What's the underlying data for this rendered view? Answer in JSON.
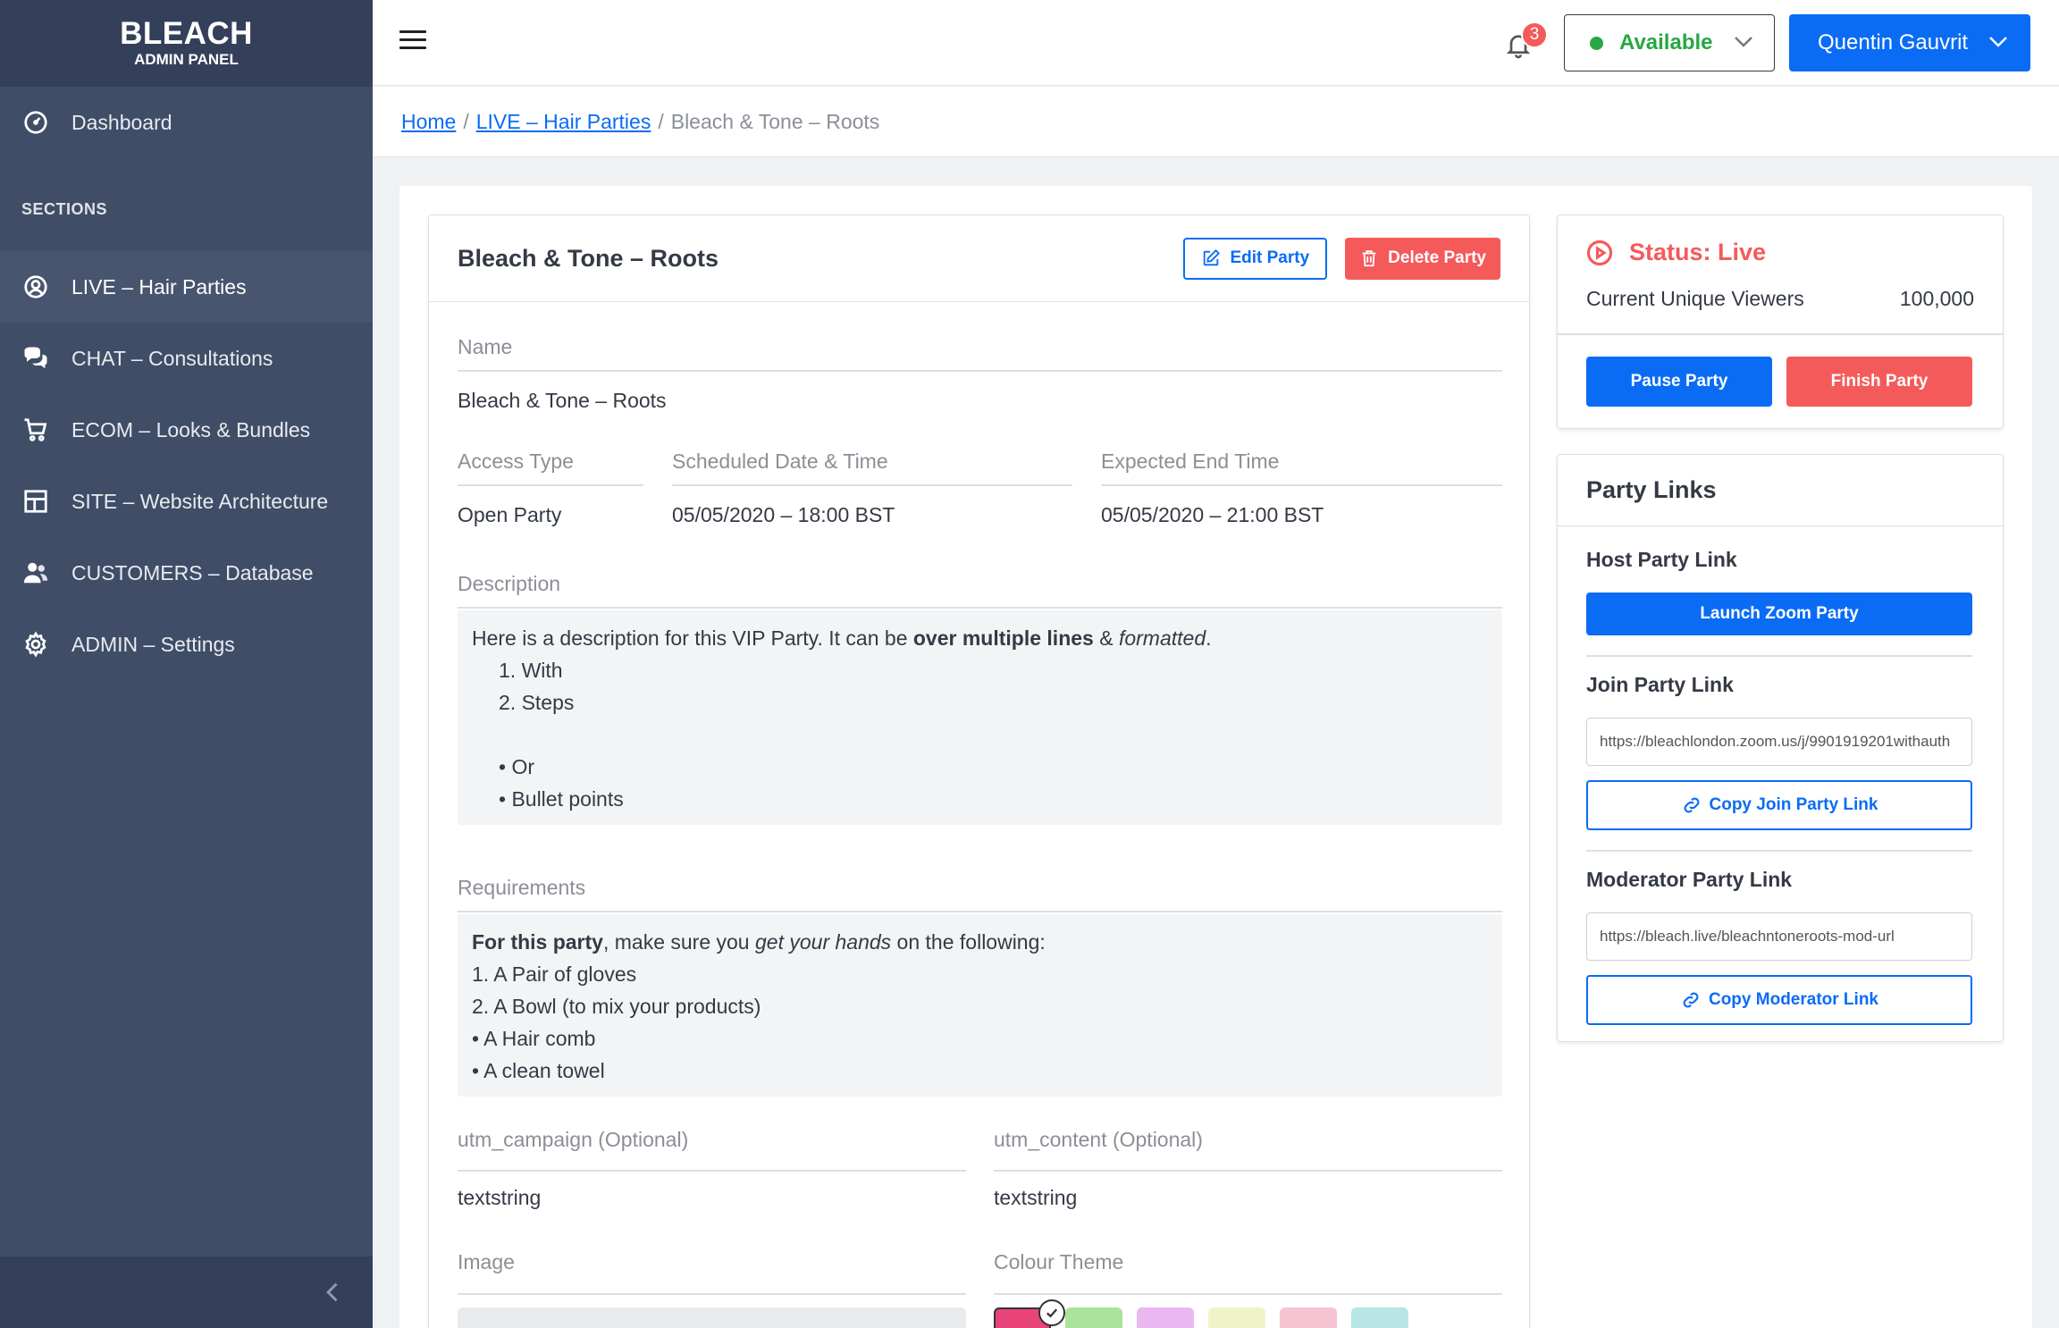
{
  "brand": {
    "title": "BLEACH",
    "subtitle": "ADMIN PANEL"
  },
  "sidebar": {
    "dashboard": "Dashboard",
    "sections_label": "SECTIONS",
    "items": [
      {
        "label": "LIVE – Hair Parties",
        "icon": "user-circle-icon",
        "active": true
      },
      {
        "label": "CHAT – Consultations",
        "icon": "chat-icon"
      },
      {
        "label": "ECOM – Looks & Bundles",
        "icon": "cart-icon"
      },
      {
        "label": "SITE – Website Architecture",
        "icon": "layout-icon"
      },
      {
        "label": "CUSTOMERS – Database",
        "icon": "users-icon"
      },
      {
        "label": "ADMIN – Settings",
        "icon": "gear-icon"
      }
    ]
  },
  "header": {
    "notification_count": "3",
    "availability": "Available",
    "user_name": "Quentin Gauvrit"
  },
  "breadcrumb": {
    "home": "Home",
    "section": "LIVE – Hair Parties",
    "current": "Bleach & Tone – Roots",
    "separator": "/"
  },
  "party": {
    "title": "Bleach & Tone – Roots",
    "edit_label": "Edit Party",
    "delete_label": "Delete Party",
    "name_label": "Name",
    "name_value": "Bleach & Tone – Roots",
    "access_label": "Access Type",
    "access_value": "Open Party",
    "scheduled_label": "Scheduled Date & Time",
    "scheduled_value": "05/05/2020 – 18:00 BST",
    "end_label": "Expected End Time",
    "end_value": "05/05/2020 – 21:00 BST",
    "description_label": "Description",
    "description": {
      "intro": "Here is a description for this VIP Party. It can be ",
      "bold": "over multiple lines",
      "amp": " & ",
      "italic": "formatted",
      "dot": ".",
      "step1": "1. With",
      "step2": "2. Steps",
      "bullet1": "• Or",
      "bullet2": "• Bullet points"
    },
    "requirements_label": "Requirements",
    "requirements": {
      "bold": "For this party",
      "mid": ", make sure you ",
      "italic": "get your hands",
      "end": " on the following:",
      "item1": "1. A Pair of gloves",
      "item2": "2. A Bowl (to mix your products)",
      "item3": "• A Hair comb",
      "item4": "• A clean towel"
    },
    "utm_campaign_label": "utm_campaign (Optional)",
    "utm_campaign_value": "textstring",
    "utm_content_label": "utm_content (Optional)",
    "utm_content_value": "textstring",
    "image_label": "Image",
    "colour_label": "Colour Theme",
    "colours": [
      "#e8447a",
      "#a9e49a",
      "#e9b8f0",
      "#f0f3c8",
      "#f6c3d3",
      "#b7e6e4"
    ]
  },
  "status": {
    "title": "Status: Live",
    "viewers_label": "Current Unique Viewers",
    "viewers_value": "100,000",
    "pause_label": "Pause Party",
    "finish_label": "Finish Party"
  },
  "links": {
    "title": "Party Links",
    "host_label": "Host Party Link",
    "zoom_label": "Launch Zoom Party",
    "join_label": "Join Party Link",
    "join_url": "https://bleachlondon.zoom.us/j/9901919201withauth",
    "copy_join_label": "Copy Join Party Link",
    "moderator_label": "Moderator Party Link",
    "moderator_url": "https://bleach.live/bleachntoneroots-mod-url",
    "copy_moderator_label": "Copy Moderator Link"
  }
}
